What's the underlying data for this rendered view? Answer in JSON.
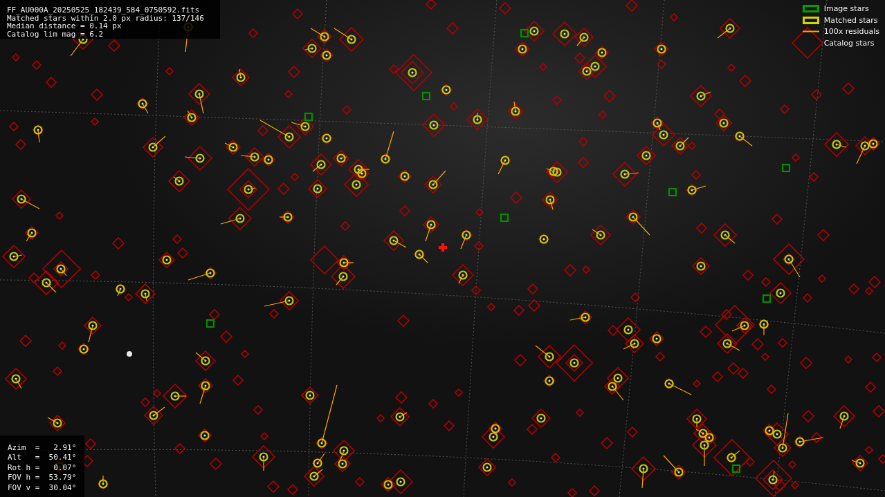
{
  "file_info": [
    "FF_AU000A_20250525_182439_584_0750592.fits",
    "Matched stars within 2.0 px radius: 137/146",
    "Median distance = 0.14 px",
    "Catalog lim mag = 6.2"
  ],
  "legend": [
    {
      "kind": "box",
      "color": "#00a000",
      "label": "Image stars"
    },
    {
      "kind": "box",
      "color": "#d4d400",
      "label": "Matched stars"
    },
    {
      "kind": "line",
      "color": "#ffa500",
      "label": "100x residuals"
    },
    {
      "kind": "diamond",
      "label": "Catalog stars"
    }
  ],
  "pointing": [
    "Azim  =   2.91°",
    "Alt   =  50.41°",
    "Rot h =   0.07°",
    "FOV h =  53.79°",
    "FOV v =  30.04°"
  ]
}
